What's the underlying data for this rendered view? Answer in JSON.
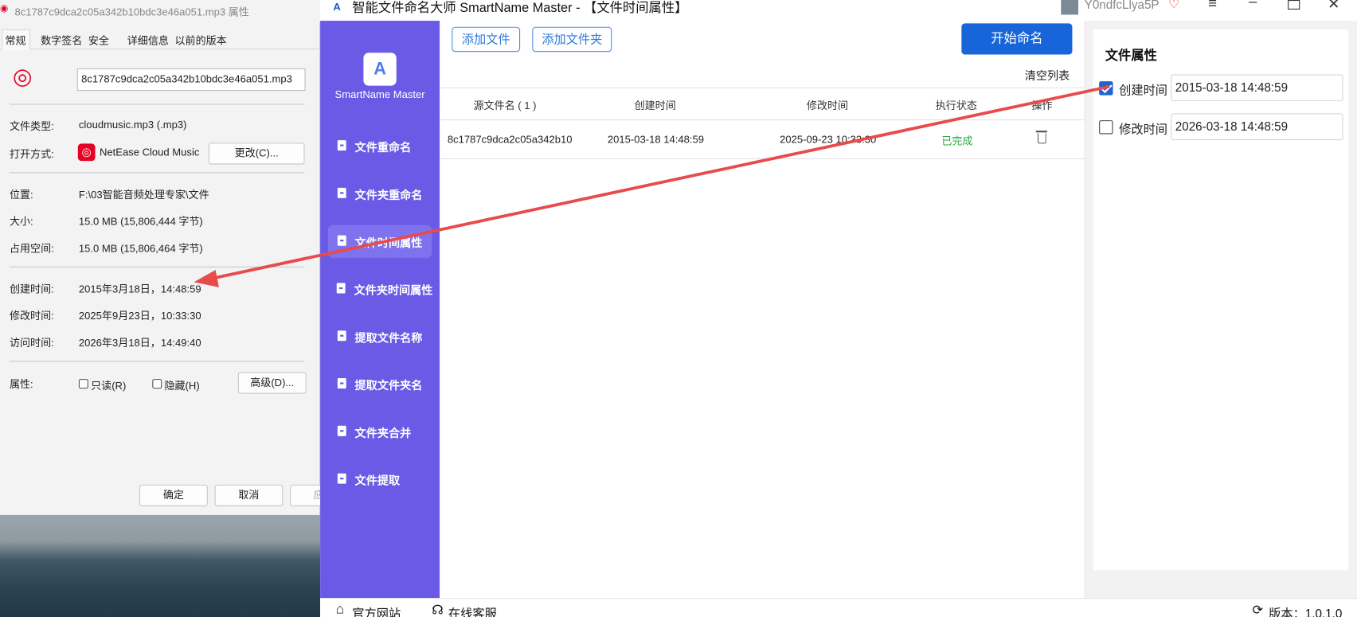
{
  "properties": {
    "title": "8c1787c9dca2c05a342b10bdc3e46a051.mp3 属性",
    "tabs": [
      "常规",
      "数字签名",
      "安全",
      "详细信息",
      "以前的版本"
    ],
    "filename": "8c1787c9dca2c05a342b10bdc3e46a051.mp3",
    "type_label": "文件类型:",
    "type_value": "cloudmusic.mp3 (.mp3)",
    "open_label": "打开方式:",
    "open_value": "NetEase Cloud Music",
    "change_button": "更改(C)...",
    "location_label": "位置:",
    "location_value": "F:\\03智能音频处理专家\\文件",
    "size_label": "大小:",
    "size_value": "15.0 MB (15,806,444 字节)",
    "disk_label": "占用空间:",
    "disk_value": "15.0 MB (15,806,464 字节)",
    "created_label": "创建时间:",
    "created_value": "2015年3月18日，14:48:59",
    "modified_label": "修改时间:",
    "modified_value": "2025年9月23日，10:33:30",
    "accessed_label": "访问时间:",
    "accessed_value": "2026年3月18日，14:49:40",
    "attr_label": "属性:",
    "readonly_label": "只读(R)",
    "hidden_label": "隐藏(H)",
    "advanced_button": "高级(D)...",
    "ok_button": "确定",
    "cancel_button": "取消",
    "apply_button": "应用"
  },
  "app": {
    "title": "智能文件命名大师 SmartName Master - 【文件时间属性】",
    "user": "Y0ndfcLlya5P",
    "brand": "SmartName Master",
    "nav": [
      "文件重命名",
      "文件夹重命名",
      "文件时间属性",
      "文件夹时间属性",
      "提取文件名称",
      "提取文件夹名",
      "文件夹合并",
      "文件提取"
    ],
    "add_file": "添加文件",
    "add_folder": "添加文件夹",
    "start": "开始命名",
    "clear_list": "清空列表",
    "headers": [
      "源文件名 ( 1 )",
      "创建时间",
      "修改时间",
      "执行状态",
      "操作"
    ],
    "row": {
      "name": "8c1787c9dca2c05a342b10",
      "created": "2015-03-18 14:48:59",
      "modified": "2025-09-23 10:33:30",
      "status": "已完成"
    },
    "panel_title": "文件属性",
    "create_time_label": "创建时间",
    "create_time_value": "2015-03-18 14:48:59",
    "create_time_checked": true,
    "modify_time_label": "修改时间",
    "modify_time_value": "2026-03-18 14:48:59",
    "modify_time_checked": false,
    "official_site": "官方网站",
    "online_service": "在线客服",
    "version": "版本：1.0.1.0"
  }
}
